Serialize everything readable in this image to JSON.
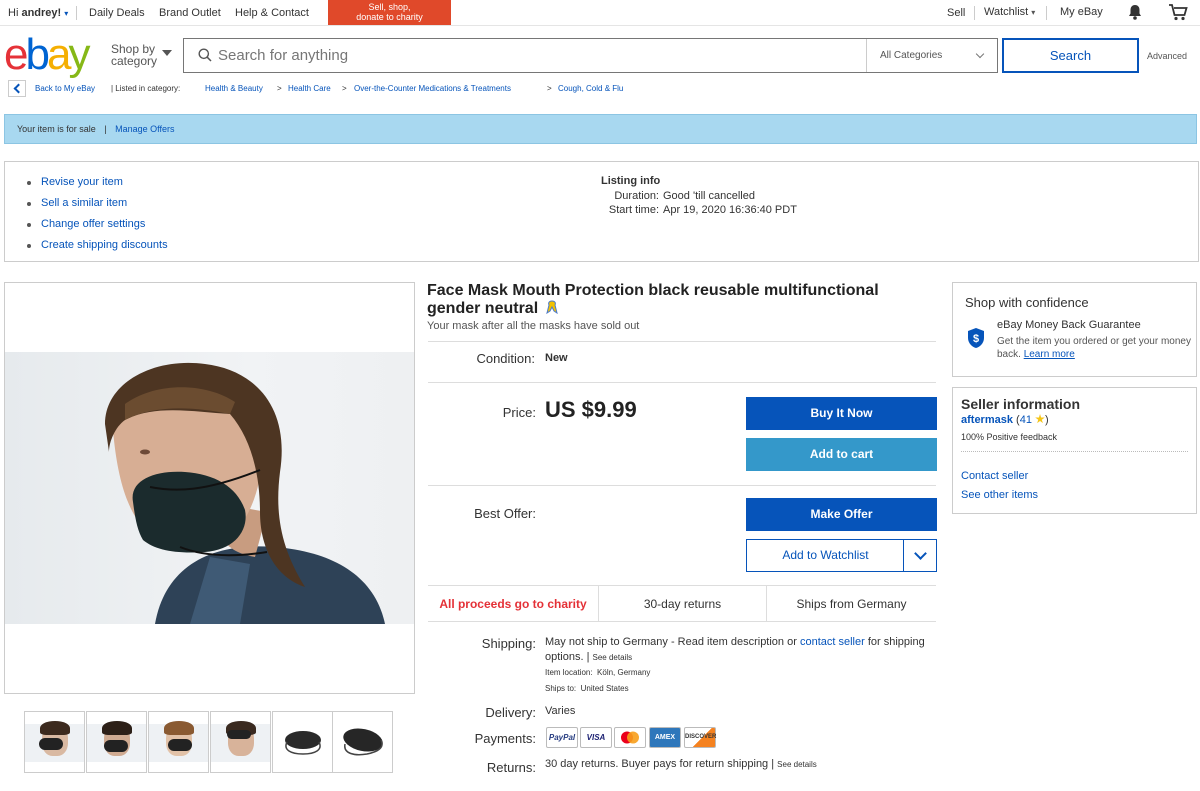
{
  "global_header": {
    "greeting": "Hi",
    "user": "andrey!",
    "links": [
      "Daily Deals",
      "Brand Outlet",
      "Help & Contact"
    ],
    "charity_banner": [
      "Sell, shop,",
      "donate to charity"
    ],
    "right_links": {
      "sell": "Sell",
      "watchlist": "Watchlist",
      "my_ebay": "My eBay"
    }
  },
  "logo": {
    "e": "e",
    "b": "b",
    "a": "a",
    "y": "y"
  },
  "search": {
    "shop_by": [
      "Shop by",
      "category"
    ],
    "placeholder": "Search for anything",
    "category": "All Categories",
    "button": "Search",
    "advanced": "Advanced"
  },
  "breadcrumb": {
    "back": "Back to My eBay",
    "listed_in": "| Listed in category:",
    "items": [
      "Health & Beauty",
      "Health Care",
      "Over-the-Counter Medications & Treatments",
      "Cough, Cold & Flu"
    ],
    "separator": ">"
  },
  "sale_banner": {
    "text": "Your item is for sale",
    "divider": "|",
    "link": "Manage Offers"
  },
  "manage_links": [
    "Revise your item",
    "Sell a similar item",
    "Change offer settings",
    "Create shipping discounts"
  ],
  "listing_info": {
    "title": "Listing info",
    "duration_label": "Duration:",
    "duration": "Good 'till cancelled",
    "start_label": "Start time:",
    "start": "Apr 19, 2020 16:36:40 PDT"
  },
  "item": {
    "title": "Face Mask Mouth Protection black reusable multifunctional gender neutral",
    "subtitle": "Your mask after all the masks have sold out",
    "condition_label": "Condition:",
    "condition": "New",
    "price_label": "Price:",
    "price": "US $9.99",
    "best_offer_label": "Best Offer:"
  },
  "buttons": {
    "buy_now": "Buy It Now",
    "add_cart": "Add to cart",
    "make_offer": "Make Offer",
    "watchlist": "Add to Watchlist"
  },
  "features": {
    "charity": "All proceeds go to charity",
    "returns": "30-day returns",
    "ships": "Ships from Germany"
  },
  "shipping": {
    "label": "Shipping:",
    "text_pre": "May not ship to Germany - Read item description or",
    "contact_link": "contact seller",
    "text_post": "for shipping options.",
    "pipe": "|",
    "see_details": "See details",
    "location_label": "Item location:",
    "location": "Köln, Germany",
    "ships_to_label": "Ships to:",
    "ships_to": "United States"
  },
  "delivery": {
    "label": "Delivery:",
    "value": "Varies"
  },
  "payments": {
    "label": "Payments:",
    "methods": [
      "PayPal",
      "VISA",
      "MC",
      "AMEX",
      "DISCOVER"
    ]
  },
  "returns": {
    "label": "Returns:",
    "text": "30 day returns. Buyer pays for return shipping |",
    "see_details": "See details"
  },
  "confidence": {
    "title": "Shop with confidence",
    "mbg_title": "eBay Money Back Guarantee",
    "mbg_desc": "Get the item you ordered or get your money back.",
    "learn_more": "Learn more"
  },
  "seller": {
    "title": "Seller information",
    "name": "aftermask",
    "feedback_count": "41",
    "positive": "100% Positive feedback",
    "contact": "Contact seller",
    "other_items": "See other items"
  },
  "thumbnails": [
    "thumb-1",
    "thumb-2",
    "thumb-3",
    "thumb-4",
    "thumb-5",
    "thumb-6"
  ],
  "colors": {
    "brand_blue": "#0654ba",
    "light_blue": "#3498ca",
    "banner": "#a8d8f0",
    "charity_red": "#e43137"
  }
}
